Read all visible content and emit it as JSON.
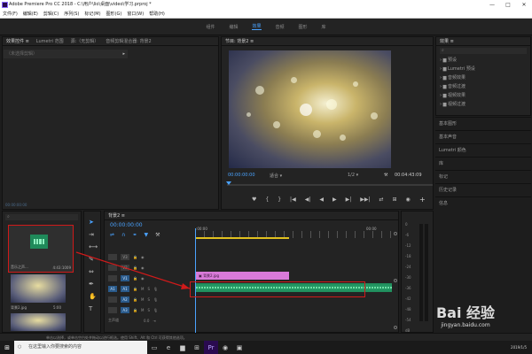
{
  "window": {
    "title": "Adobe Premiere Pro CC 2018 - C:\\用户\\lio\\桌面\\video\\学习.prproj *",
    "minimize": "—",
    "maximize": "□",
    "close": "✕"
  },
  "menu": [
    "文件(F)",
    "编辑(E)",
    "剪辑(C)",
    "序列(S)",
    "标记(M)",
    "图形(G)",
    "窗口(W)",
    "帮助(H)"
  ],
  "workspaces": [
    {
      "label": "组件",
      "active": false
    },
    {
      "label": "编辑",
      "active": false
    },
    {
      "label": "效果",
      "active": true
    },
    {
      "label": "音频",
      "active": false
    },
    {
      "label": "图形",
      "active": false
    },
    {
      "label": "库",
      "active": false
    }
  ],
  "source_panel": {
    "tabs": [
      "效果控件 ≡",
      "Lumetri 范围",
      "源:（无剪辑）",
      "音频剪辑混合器: 背景2"
    ],
    "no_clip": "（未选择剪辑）",
    "timecode": "00:00:00:00"
  },
  "program_monitor": {
    "title": "节目: 背景2 ≡",
    "timecode": "00:00:00:00",
    "fit": "适合",
    "quality": "1/2",
    "duration": "00:04:43:09",
    "controls": [
      "♥",
      "{",
      "}",
      "|◀",
      "◀|",
      "◀",
      "▶",
      "▶|",
      "▶▶|",
      "⇄",
      "⊞",
      "◉"
    ],
    "add_button": "+"
  },
  "effects_panel": {
    "title": "效果 ≡",
    "items": [
      "预设",
      "Lumetri 预设",
      "音频效果",
      "音频过渡",
      "视频效果",
      "视频过渡"
    ]
  },
  "side_panels": [
    "基本图形",
    "基本声音",
    "Lumetri 颜色",
    "库",
    "标记",
    "历史记录",
    "信息"
  ],
  "project_panel": {
    "items": [
      {
        "name": "音乐之声...",
        "duration": "4:43:1009"
      },
      {
        "name": "背景2.jpg",
        "duration": "5:00"
      }
    ]
  },
  "timeline": {
    "title": "背景2 ≡",
    "timecode": "00:00:00:00",
    "ruler_start": ":00:00",
    "ruler_end": "00:00",
    "video_tracks": [
      "V3",
      "V2",
      "V1"
    ],
    "audio_tracks": [
      "A1",
      "A2",
      "A3"
    ],
    "master_label": "主声道",
    "master_value": "0.0",
    "clip_label": "背景2.jpg",
    "db_scale": [
      "0",
      "-6",
      "-12",
      "-18",
      "-24",
      "-30",
      "-36",
      "-42",
      "-48",
      "-54"
    ],
    "db_unit": "dB"
  },
  "status_bar": "单击以选择，或单击空白处并拖动以进行框选。使用 Shift、Alt 和 Ctrl 可获得其他选项。",
  "taskbar": {
    "start": "⊞",
    "search_placeholder": "在这里输入你要搜索的内容",
    "clock_date": "2019/1/5"
  },
  "watermark": {
    "text": "Bai 经验",
    "url": "jingyan.baidu.com"
  },
  "colors": {
    "accent": "#4aa3ff",
    "audio_clip": "#1f8a5a",
    "video_clip": "#d87ad8",
    "annotation": "#d01a1a"
  }
}
